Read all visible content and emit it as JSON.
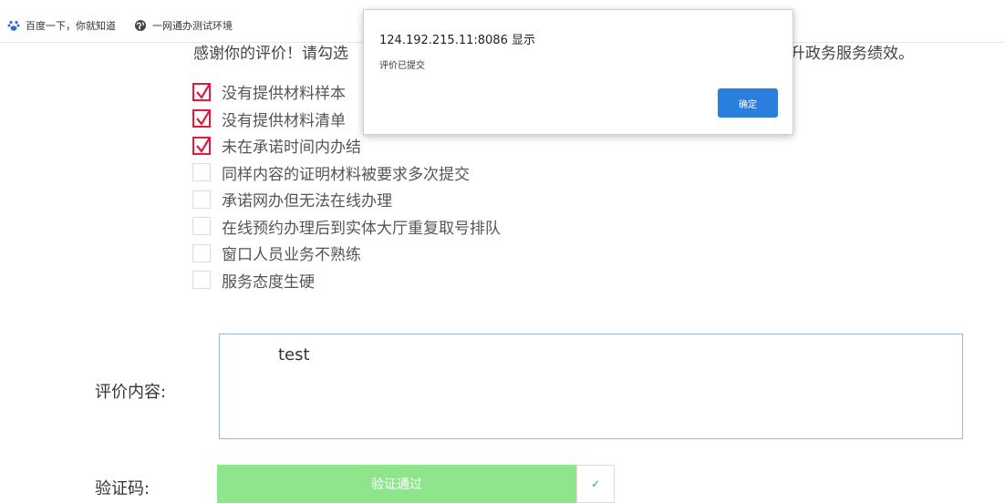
{
  "bookmarks": [
    {
      "label": "百度一下，你就知道",
      "icon": "baidu-paw-icon"
    },
    {
      "label": "一网通办测试环境",
      "icon": "globe-icon"
    }
  ],
  "intro": {
    "text_start": "感谢你的评价！请勾选",
    "text_end": "升政务服务绩效。"
  },
  "reasons": [
    {
      "label": "没有提供材料样本",
      "checked": true
    },
    {
      "label": "没有提供材料清单",
      "checked": true
    },
    {
      "label": "未在承诺时间内办结",
      "checked": true
    },
    {
      "label": "同样内容的证明材料被要求多次提交",
      "checked": false
    },
    {
      "label": "承诺网办但无法在线办理",
      "checked": false
    },
    {
      "label": "在线预约办理后到实体大厅重复取号排队",
      "checked": false
    },
    {
      "label": "窗口人员业务不熟练",
      "checked": false
    },
    {
      "label": "服务态度生硬",
      "checked": false
    }
  ],
  "review": {
    "label": "评价内容:",
    "value": "test"
  },
  "captcha": {
    "label": "验证码:",
    "status": "验证通过",
    "handle_symbol": "✓"
  },
  "dialog": {
    "title": "124.192.215.11:8086 显示",
    "message": "评价已提交",
    "ok_label": "确定"
  },
  "colors": {
    "checkbox_checked": "#e01b3c",
    "captcha_success": "#8ee58b",
    "dialog_button": "#2a7fde"
  }
}
